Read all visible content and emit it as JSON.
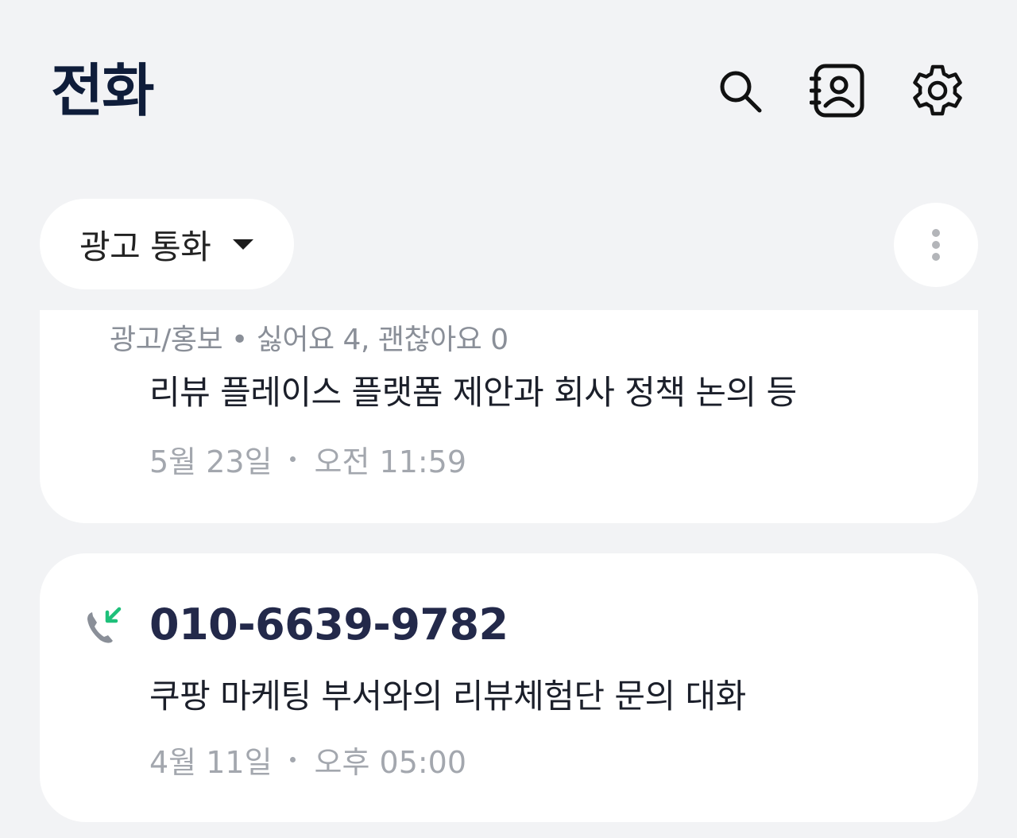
{
  "header": {
    "title": "전화"
  },
  "filter": {
    "label": "광고 통화"
  },
  "cards": [
    {
      "category": "광고/홍보 • 싫어요 4, 괜찮아요 0",
      "summary": "리뷰 플레이스 플랫폼 제안과 회사 정책 논의 등",
      "date": "5월 23일",
      "time": "오전 11:59"
    },
    {
      "number": "010-6639-9782",
      "summary": "쿠팡 마케팅 부서와의 리뷰체험단 문의 대화",
      "date": "4월 11일",
      "time": "오후 05:00"
    }
  ],
  "colors": {
    "background": "#f2f3f5",
    "card": "#ffffff",
    "title": "#0f1d3a",
    "number": "#23294a",
    "incoming_arrow": "#1ec07a",
    "phone_gray": "#8a8f98"
  },
  "icons": [
    "search-icon",
    "contacts-icon",
    "settings-icon",
    "chevron-down-icon",
    "more-vertical-icon",
    "incoming-call-icon"
  ]
}
